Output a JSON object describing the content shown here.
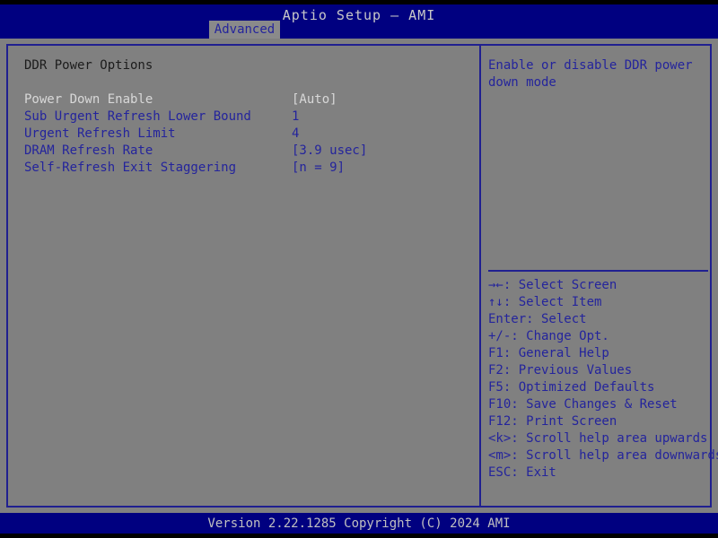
{
  "header": {
    "title": "Aptio Setup – AMI",
    "tab": "Advanced"
  },
  "main": {
    "section_title": "DDR Power Options",
    "options": [
      {
        "label": "Power Down Enable",
        "value": "[Auto]",
        "selected": true
      },
      {
        "label": "Sub Urgent Refresh Lower Bound",
        "value": "1",
        "selected": false
      },
      {
        "label": "Urgent Refresh Limit",
        "value": "4",
        "selected": false
      },
      {
        "label": "DRAM Refresh Rate",
        "value": "[3.9 usec]",
        "selected": false
      },
      {
        "label": "Self-Refresh Exit Staggering",
        "value": "[n = 9]",
        "selected": false
      }
    ]
  },
  "help": {
    "text": "Enable or disable DDR power down mode",
    "legend": [
      "→←: Select Screen",
      "↑↓: Select Item",
      "Enter: Select",
      "+/-: Change Opt.",
      "F1: General Help",
      "F2: Previous Values",
      "F5: Optimized Defaults",
      "F10: Save Changes & Reset",
      "F12: Print Screen",
      "<k>: Scroll help area upwards",
      "<m>: Scroll help area downwards",
      "ESC: Exit"
    ]
  },
  "footer": {
    "version": "Version 2.22.1285 Copyright (C) 2024 AMI"
  },
  "colors": {
    "background": "#808080",
    "accent_blue": "#000080",
    "text_blue": "#24249c",
    "text_selected": "#d8d8d8",
    "border": "#202090"
  }
}
